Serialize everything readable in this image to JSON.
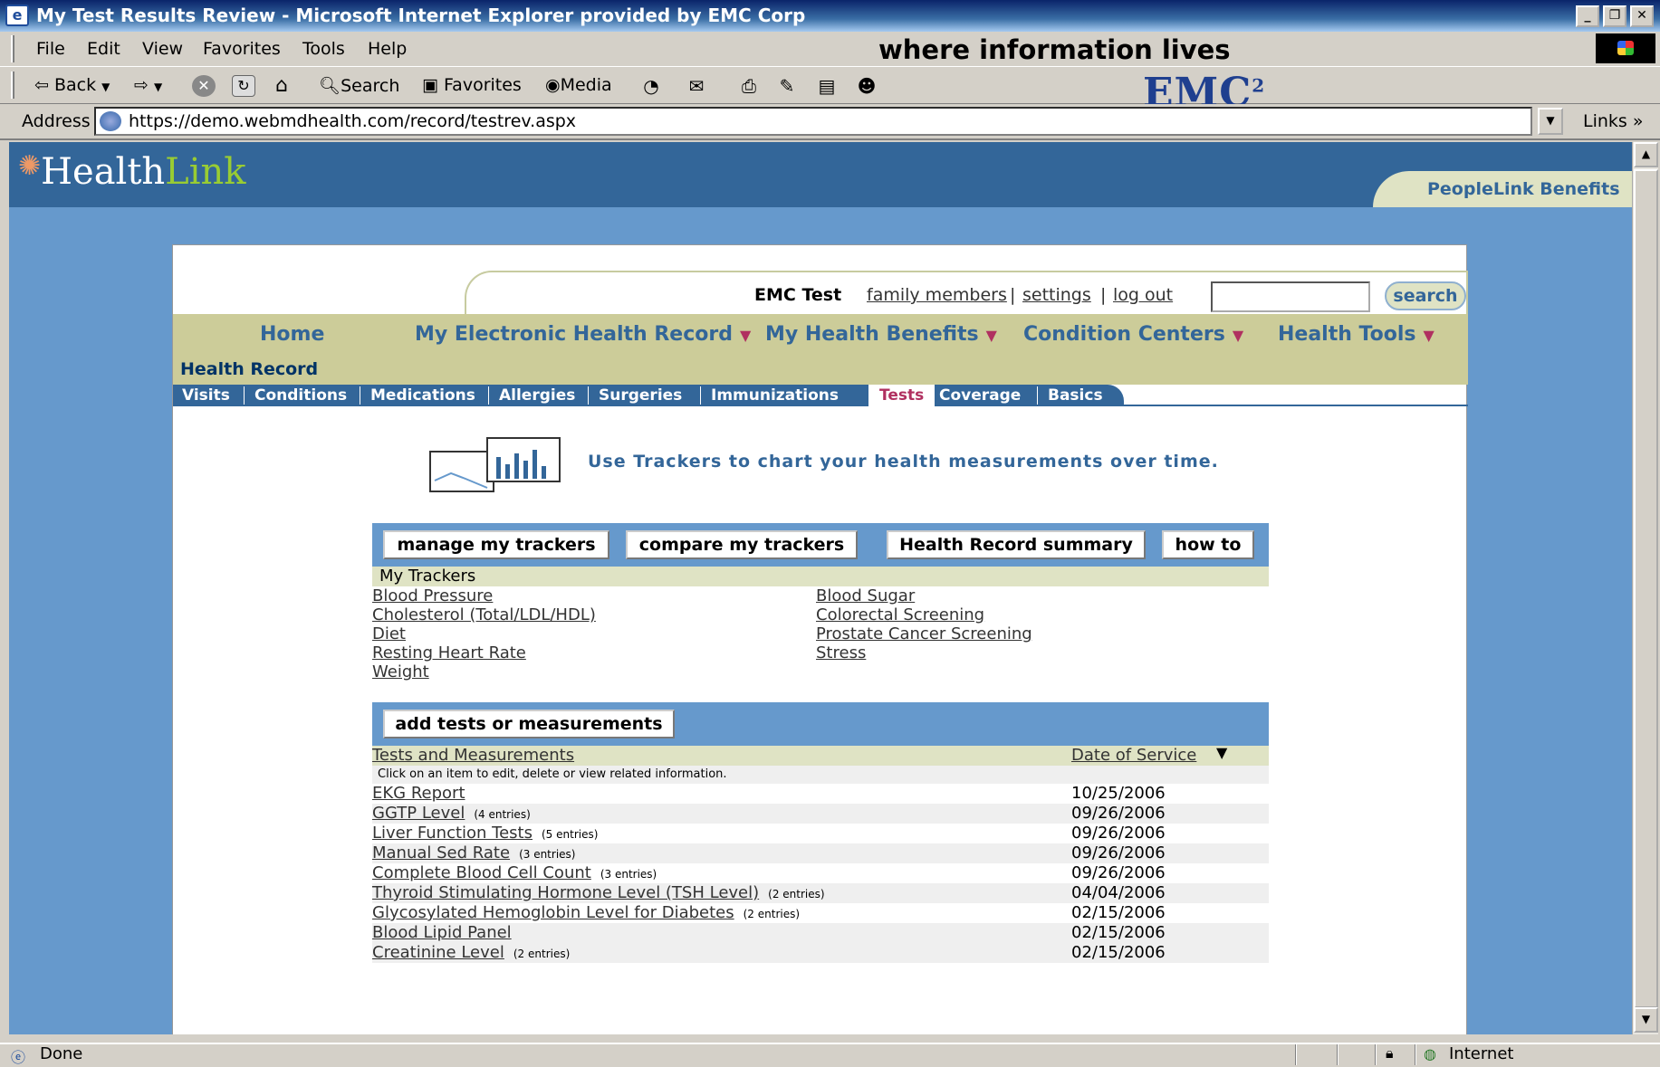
{
  "window": {
    "title": "My Test Results Review - Microsoft Internet Explorer provided by EMC Corp",
    "minimize": "_",
    "restore": "❐",
    "close": "✕"
  },
  "menu": {
    "items": [
      "File",
      "Edit",
      "View",
      "Favorites",
      "Tools",
      "Help"
    ],
    "slogan": "where information lives"
  },
  "toolbar": {
    "back": "Back",
    "search": "Search",
    "favorites": "Favorites",
    "media": "Media",
    "brand": "EMC",
    "brand_sup": "2"
  },
  "address": {
    "label": "Address",
    "url": "https://demo.webmdhealth.com/record/testrev.aspx",
    "links": "Links"
  },
  "site": {
    "logo_health": "Health",
    "logo_link": "Link",
    "partner": "PeopleLink Benefits"
  },
  "user": {
    "name": "EMC Test",
    "family": "family members",
    "settings": "settings",
    "logout": "log out",
    "sep": "|",
    "search_value": "",
    "search_button": "search"
  },
  "nav": {
    "items": [
      "Home",
      "My Electronic Health Record",
      "My Health Benefits",
      "Condition Centers",
      "Health Tools"
    ],
    "arrow": "▼"
  },
  "health_record": {
    "title": "Health Record",
    "tabs": [
      "Visits",
      "Conditions",
      "Medications",
      "Allergies",
      "Surgeries",
      "Immunizations",
      "Tests",
      "Coverage",
      "Basics"
    ],
    "active_tab": "Tests"
  },
  "promo": {
    "text": "Use Trackers to chart your health measurements over time."
  },
  "tracker_buttons": [
    "manage my trackers",
    "compare my trackers",
    "Health Record summary",
    "how to"
  ],
  "trackers": {
    "title": "My Trackers",
    "left": [
      "Blood Pressure",
      "Cholesterol (Total/LDL/HDL)",
      "Diet",
      "Resting Heart Rate",
      "Weight"
    ],
    "right": [
      "Blood Sugar",
      "Colorectal Screening",
      "Prostate Cancer Screening",
      "Stress"
    ]
  },
  "tests": {
    "add_button": "add tests or measurements",
    "col_name": "Tests and Measurements",
    "col_date": "Date of Service",
    "sort_icon": "▼",
    "hint": "Click on an item to edit, delete or view related information.",
    "rows": [
      {
        "name": "EKG Report",
        "count": "",
        "date": "10/25/2006"
      },
      {
        "name": "GGTP Level",
        "count": "(4 entries)",
        "date": "09/26/2006"
      },
      {
        "name": "Liver Function Tests",
        "count": "(5 entries)",
        "date": "09/26/2006"
      },
      {
        "name": "Manual Sed Rate",
        "count": "(3 entries)",
        "date": "09/26/2006"
      },
      {
        "name": "Complete Blood Cell Count",
        "count": "(3 entries)",
        "date": "09/26/2006"
      },
      {
        "name": "Thyroid Stimulating Hormone Level (TSH Level)",
        "count": "(2 entries)",
        "date": "04/04/2006"
      },
      {
        "name": "Glycosylated Hemoglobin Level for Diabetes",
        "count": "(2 entries)",
        "date": "02/15/2006"
      },
      {
        "name": "Blood Lipid Panel",
        "count": "",
        "date": "02/15/2006"
      },
      {
        "name": "Creatinine Level",
        "count": "(2 entries)",
        "date": "02/15/2006"
      }
    ]
  },
  "status": {
    "text": "Done",
    "zone": "Internet"
  }
}
